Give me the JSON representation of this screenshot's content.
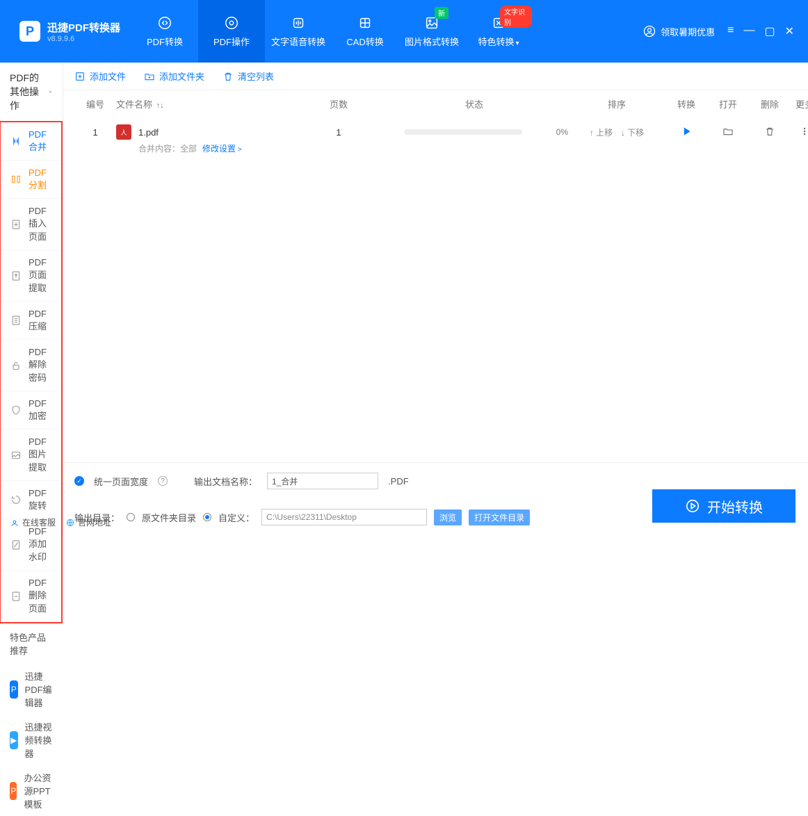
{
  "app": {
    "title": "迅捷PDF转换器",
    "version": "v8.9.9.6"
  },
  "nav": {
    "items": [
      {
        "label": "PDF转换"
      },
      {
        "label": "PDF操作"
      },
      {
        "label": "文字语音转换"
      },
      {
        "label": "CAD转换"
      },
      {
        "label": "图片格式转换",
        "badge_new": "新"
      },
      {
        "label": "特色转换",
        "badge_red": "文字识别"
      }
    ],
    "promo": "领取暑期优惠"
  },
  "sidebar": {
    "header": "PDF的其他操作",
    "items": [
      {
        "label": "PDF合并"
      },
      {
        "label": "PDF分割"
      },
      {
        "label": "PDF插入页面"
      },
      {
        "label": "PDF页面提取"
      },
      {
        "label": "PDF压缩"
      },
      {
        "label": "PDF解除密码"
      },
      {
        "label": "PDF加密"
      },
      {
        "label": "PDF图片提取"
      },
      {
        "label": "PDF旋转"
      },
      {
        "label": "PDF添加水印"
      },
      {
        "label": "PDF删除页面"
      }
    ],
    "recommend_header": "特色产品推荐",
    "recommend": [
      {
        "label": "迅捷PDF编辑器"
      },
      {
        "label": "迅捷视频转换器"
      },
      {
        "label": "办公资源PPT模板"
      }
    ],
    "footer": {
      "service": "在线客服",
      "site": "官网地址"
    }
  },
  "toolbar": {
    "add_file": "添加文件",
    "add_folder": "添加文件夹",
    "clear": "清空列表"
  },
  "table": {
    "headers": {
      "idx": "编号",
      "name": "文件名称",
      "pages": "页数",
      "status": "状态",
      "order": "排序",
      "convert": "转换",
      "open": "打开",
      "delete": "删除",
      "more": "更多"
    },
    "rows": [
      {
        "idx": "1",
        "name": "1.pdf",
        "pages": "1",
        "progress": "0%",
        "up": "上移",
        "down": "下移"
      }
    ],
    "sub": {
      "prefix": "合并内容：全部",
      "link": "修改设置"
    }
  },
  "options": {
    "uniform_width": "统一页面宽度",
    "out_name_label": "输出文档名称：",
    "out_name_value": "1_合并",
    "out_ext": ".PDF",
    "out_dir_label": "输出目录：",
    "orig_dir": "原文件夹目录",
    "custom": "自定义：",
    "path": "C:\\Users\\22311\\Desktop",
    "browse": "浏览",
    "open_dir": "打开文件目录",
    "start": "开始转换"
  }
}
